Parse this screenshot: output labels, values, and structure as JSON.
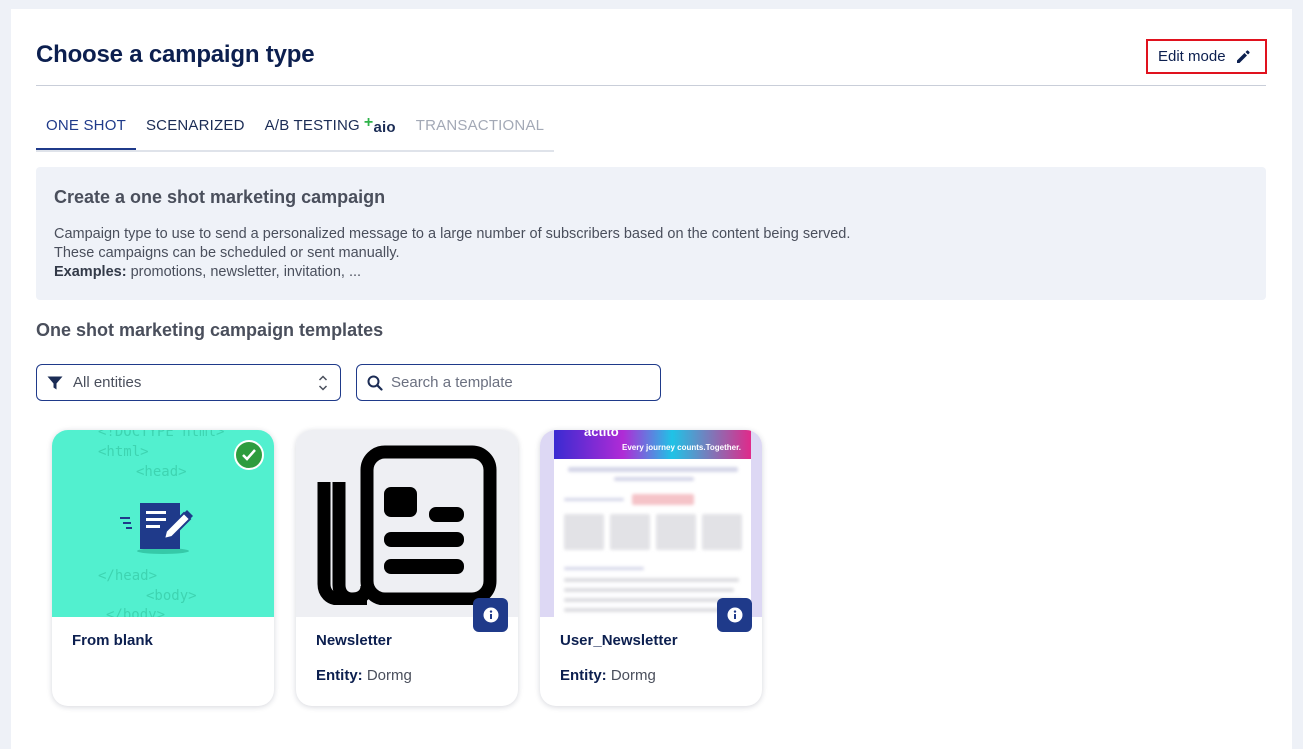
{
  "header": {
    "title": "Choose a campaign type",
    "edit_mode_label": "Edit mode"
  },
  "tabs": [
    {
      "label": "ONE SHOT",
      "state": "active"
    },
    {
      "label": "SCENARIZED",
      "state": "normal"
    },
    {
      "label": "A/B TESTING",
      "state": "normal",
      "badge": "aio"
    },
    {
      "label": "TRANSACTIONAL",
      "state": "disabled"
    }
  ],
  "info": {
    "title": "Create a one shot marketing campaign",
    "line1": "Campaign type to use to send a personalized message to a large number of subscribers based on the content being served.",
    "line2": "These campaigns can be scheduled or sent manually.",
    "examples_label": "Examples:",
    "examples_text": " promotions, newsletter, invitation, ..."
  },
  "templates_section": {
    "title": "One shot marketing campaign templates"
  },
  "filters": {
    "entity_select_value": "All entities",
    "search_placeholder": "Search a template"
  },
  "cards": [
    {
      "name": "From blank",
      "selected": true,
      "code_lines": [
        "<!DOCTYPE html>",
        "<html>",
        "<head>",
        "</head>",
        "<body>",
        "</body>"
      ]
    },
    {
      "name": "Newsletter",
      "entity_label": "Entity:",
      "entity_value": "Dormg"
    },
    {
      "name": "User_Newsletter",
      "entity_label": "Entity:",
      "entity_value": "Dormg",
      "banner_brand": "actito",
      "banner_tagline": "Every journey counts.Together."
    }
  ],
  "colors": {
    "accent": "#1f3a8a",
    "title": "#0c1f4f",
    "highlight_border": "#e0121e",
    "blank_card_bg": "#52f0cf",
    "success": "#2e9c3e",
    "aio_plus": "#2fb34a"
  }
}
